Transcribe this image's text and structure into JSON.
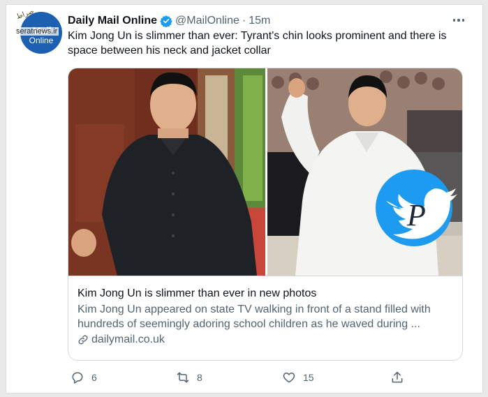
{
  "account": {
    "name": "Daily Mail Online",
    "handle": "@MailOnline",
    "separator": "·",
    "time": "15m",
    "avatar_text": "Mail",
    "avatar_subtext": "Online"
  },
  "watermark": {
    "site": "seratnews.ir",
    "top_text": "صراط"
  },
  "tweet_text": "Kim Jong Un is slimmer than ever: Tyrant's chin looks prominent and there is space between his neck and jacket collar",
  "link_card": {
    "title": "Kim Jong Un is slimmer than ever in new photos",
    "description": "Kim Jong Un appeared on state TV walking in front of a stand filled with hundreds of seemingly adoring school children as he waved during ...",
    "domain": "dailymail.co.uk"
  },
  "actions": {
    "replies": "6",
    "retweets": "8",
    "likes": "15"
  },
  "colors": {
    "verified_blue": "#1d9bf0",
    "twitter_blue": "#1d9bf0",
    "secondary_text": "#536471"
  },
  "icons": [
    "verified-icon",
    "more-icon",
    "link-icon",
    "reply-icon",
    "retweet-icon",
    "like-icon",
    "share-icon",
    "twitter-bird-icon"
  ]
}
